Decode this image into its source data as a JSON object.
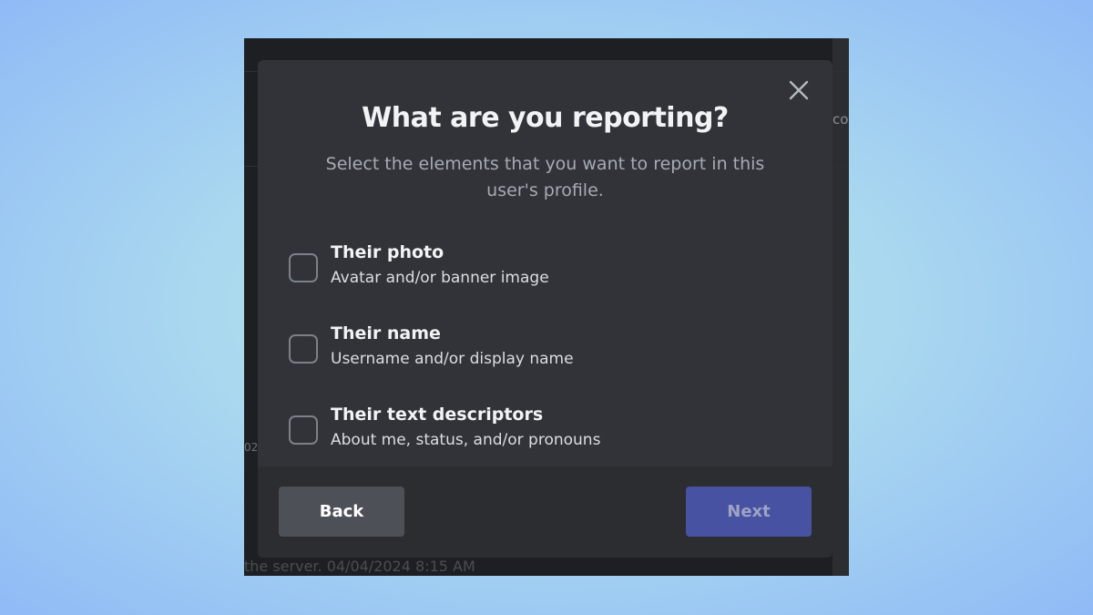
{
  "modal": {
    "title": "What are you reporting?",
    "subtitle": "Select the elements that you want to report in this user's profile.",
    "close_icon": "close-icon",
    "options": [
      {
        "title": "Their photo",
        "description": "Avatar and/or banner image",
        "checked": false
      },
      {
        "title": "Their name",
        "description": "Username and/or display name",
        "checked": false
      },
      {
        "title": "Their text descriptors",
        "description": "About me, status, and/or pronouns",
        "checked": false
      }
    ],
    "back_label": "Back",
    "next_label": "Next"
  },
  "background": {
    "right_fragment": "co",
    "left_fragment": "02",
    "bottom_text": "the server. 04/04/2024 8:15 AM"
  },
  "colors": {
    "modal_bg": "#313338",
    "footer_bg": "#2b2d31",
    "back_button": "#4e5058",
    "next_button": "#4752a2",
    "title_text": "#f2f3f5"
  }
}
